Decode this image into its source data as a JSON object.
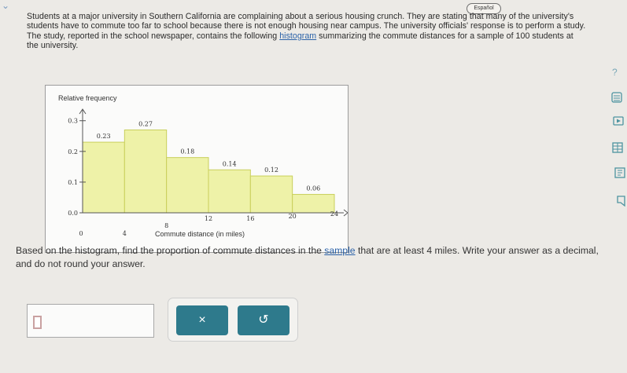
{
  "header": {
    "language_label": "Español"
  },
  "problem": {
    "text_before_link": "Students at a major university in Southern California are complaining about a serious housing crunch. They are stating that many of the university's students have to commute too far to school because there is not enough housing near campus. The university officials' response is to perform a study. The study, reported in the school newspaper, contains the following ",
    "link_text": "histogram",
    "text_after_link": " summarizing the commute distances for a sample of 100 students at the university."
  },
  "chart_data": {
    "type": "bar",
    "ylabel": "Relative frequency",
    "xlabel": "Commute distance (in miles)",
    "bin_edges": [
      0,
      4,
      8,
      12,
      16,
      20,
      24
    ],
    "x_tick_labels": [
      "0",
      "4",
      "8",
      "12",
      "16",
      "20",
      "24"
    ],
    "values": [
      0.23,
      0.27,
      0.18,
      0.14,
      0.12,
      0.06
    ],
    "value_labels": [
      "0.23",
      "0.27",
      "0.18",
      "0.14",
      "0.12",
      "0.06"
    ],
    "y_ticks": [
      0.0,
      0.1,
      0.2,
      0.3
    ],
    "y_tick_labels": [
      "0.0",
      "0.1",
      "0.2",
      "0.3"
    ],
    "ylim": [
      0,
      0.33
    ],
    "xlim": [
      0,
      24
    ],
    "bar_color": "#eef2a8",
    "bar_stroke": "#c9cf5c"
  },
  "question": {
    "before_link": "Based on the histogram, find the proportion of commute distances in the ",
    "link_text": "sample",
    "after_link": " that are at least 4 miles. Write your answer as a decimal, and do not round your answer."
  },
  "answer": {
    "value": ""
  },
  "buttons": {
    "clear_symbol": "×",
    "undo_symbol": "↺"
  },
  "side_tools": {
    "help_symbol": "?"
  }
}
